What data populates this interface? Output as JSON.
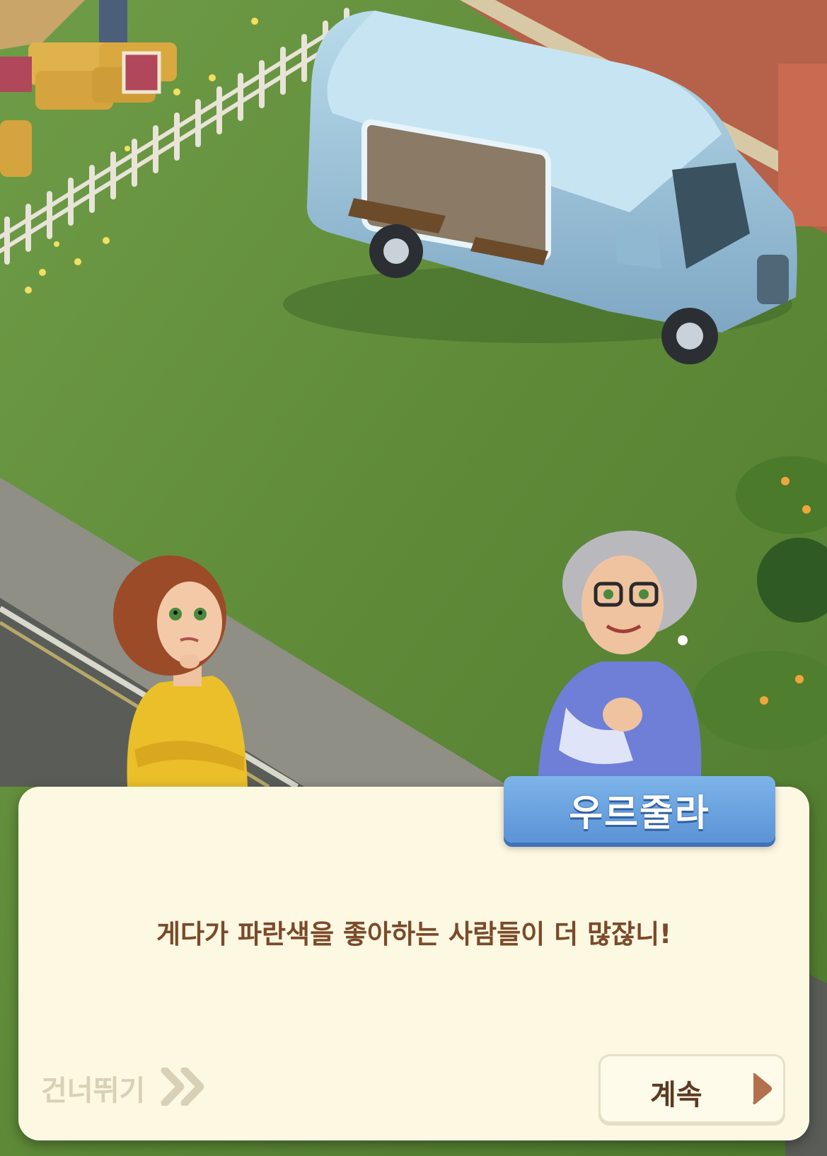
{
  "dialog": {
    "speaker_name": "우르줄라",
    "message": "게다가 파란색을 좋아하는 사람들이 더 많잖니!",
    "skip_label": "건너뛰기",
    "continue_label": "계속"
  },
  "colors": {
    "dialog_bg": "#fdf8e1",
    "name_tag": "#6ba6e4",
    "message_text": "#7a4a2a",
    "skip_text": "#d9d0b8",
    "continue_arrow": "#b3704d"
  },
  "scene": {
    "objects": [
      "farm-stand-hay-bales",
      "picket-fence",
      "blue-food-truck",
      "lawn",
      "sidewalk",
      "road",
      "brick-wall",
      "flower-bushes"
    ],
    "characters": [
      "woman-yellow-sweater-thinking",
      "grandma-ursula-purple-sweater"
    ]
  }
}
